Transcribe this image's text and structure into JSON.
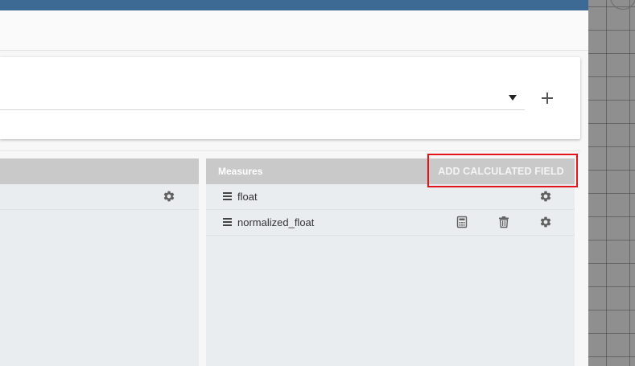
{
  "measures_panel": {
    "title": "Measures",
    "add_calculated_field_label": "ADD CALCULATED FIELD",
    "rows": [
      {
        "label": "float",
        "icons": [
          "drag-handle-icon",
          "gear-icon"
        ]
      },
      {
        "label": "normalized_float",
        "icons": [
          "drag-handle-icon",
          "calculator-icon",
          "trash-icon",
          "gear-icon"
        ]
      }
    ]
  },
  "card": {
    "add_button_icon": "plus-icon",
    "dropdown_icon": "caret-down-icon"
  },
  "colors": {
    "topbar": "#3d6a94",
    "panel_header": "#c9c9c9",
    "panel_body": "#eaedef",
    "highlight": "#e4141b"
  }
}
